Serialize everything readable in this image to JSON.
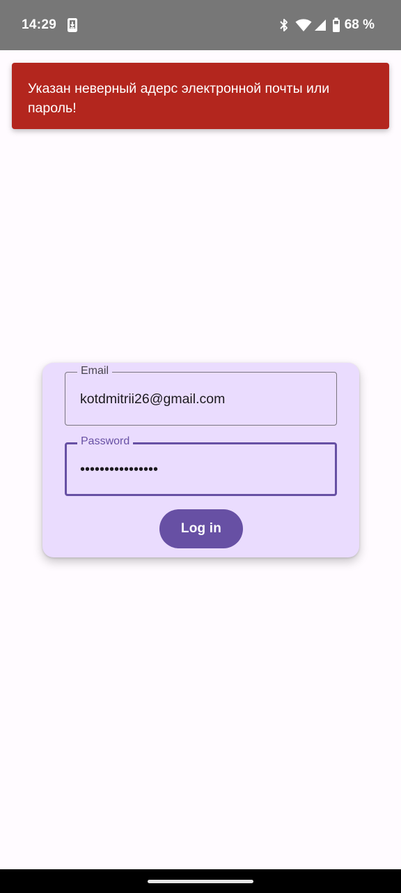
{
  "status_bar": {
    "time": "14:29",
    "icons": [
      "download-icon",
      "bluetooth-icon",
      "wifi-icon",
      "cellular-icon",
      "battery-icon"
    ],
    "battery_text": "68 %"
  },
  "error_snackbar": {
    "message": "Указан неверный адерс электронной почты или пароль!",
    "color": "#b3261e"
  },
  "login_form": {
    "email_label": "Email",
    "email_value": "kotdmitrii26@gmail.com",
    "password_label": "Password",
    "password_value": "••••••••••••••••",
    "login_button_label": "Log in",
    "accent_color": "#6750a4",
    "card_color": "#eadcfe"
  }
}
